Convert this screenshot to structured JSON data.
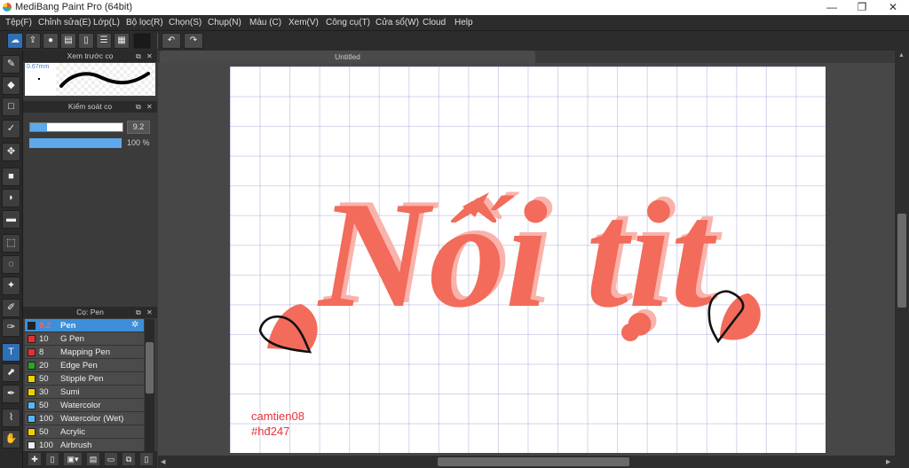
{
  "app": {
    "title": "MediBang Paint Pro (64bit)"
  },
  "window": {
    "minimize": "—",
    "maximize": "❐",
    "close": "✕"
  },
  "menu": [
    "Tệp(F)",
    "Chỉnh sửa(E)",
    "Lớp(L)",
    "Bộ lọc(R)",
    "Chọn(S)",
    "Chụp(N)",
    "Màu (C)",
    "Xem(V)",
    "Công cụ(T)",
    "Cửa sổ(W)",
    "Cloud",
    "Help"
  ],
  "toolbar": {
    "icons": [
      "cloud-icon",
      "share-icon",
      "comment-icon",
      "message-icon",
      "page-icon",
      "list-icon",
      "grid-icon",
      "color-swatch"
    ],
    "undo": "↶",
    "redo": "↷"
  },
  "brush_preview": {
    "title": "Xem trước cọ",
    "size_label": "0.67mm"
  },
  "brush_control": {
    "title": "Kiểm soát cọ",
    "size_value": "9.2",
    "size_fill": 0.18,
    "opacity_value": "100 %",
    "opacity_fill": 1.0
  },
  "brush_panel": {
    "title": "Cọ: Pen",
    "items": [
      {
        "size": "9.2",
        "name": "Pen",
        "color": "#222222",
        "selected": true
      },
      {
        "size": "10",
        "name": "G Pen",
        "color": "#e83030"
      },
      {
        "size": "8",
        "name": "Mapping Pen",
        "color": "#e83030"
      },
      {
        "size": "20",
        "name": "Edge Pen",
        "color": "#2aa52a"
      },
      {
        "size": "50",
        "name": "Stipple Pen",
        "color": "#f0d000"
      },
      {
        "size": "30",
        "name": "Sumi",
        "color": "#f0d000"
      },
      {
        "size": "50",
        "name": "Watercolor",
        "color": "#59b6f0"
      },
      {
        "size": "100",
        "name": "Watercolor (Wet)",
        "color": "#59b6f0"
      },
      {
        "size": "50",
        "name": "Acrylic",
        "color": "#f0d000"
      },
      {
        "size": "100",
        "name": "Airbrush",
        "color": "#eeeeee"
      }
    ]
  },
  "document": {
    "tab_title": "Untitled"
  },
  "artwork": {
    "main_text": "Nối tịt",
    "signature_line1": "camtien08",
    "signature_line2": "#hđ247",
    "ink_color": "#f26b5b"
  }
}
